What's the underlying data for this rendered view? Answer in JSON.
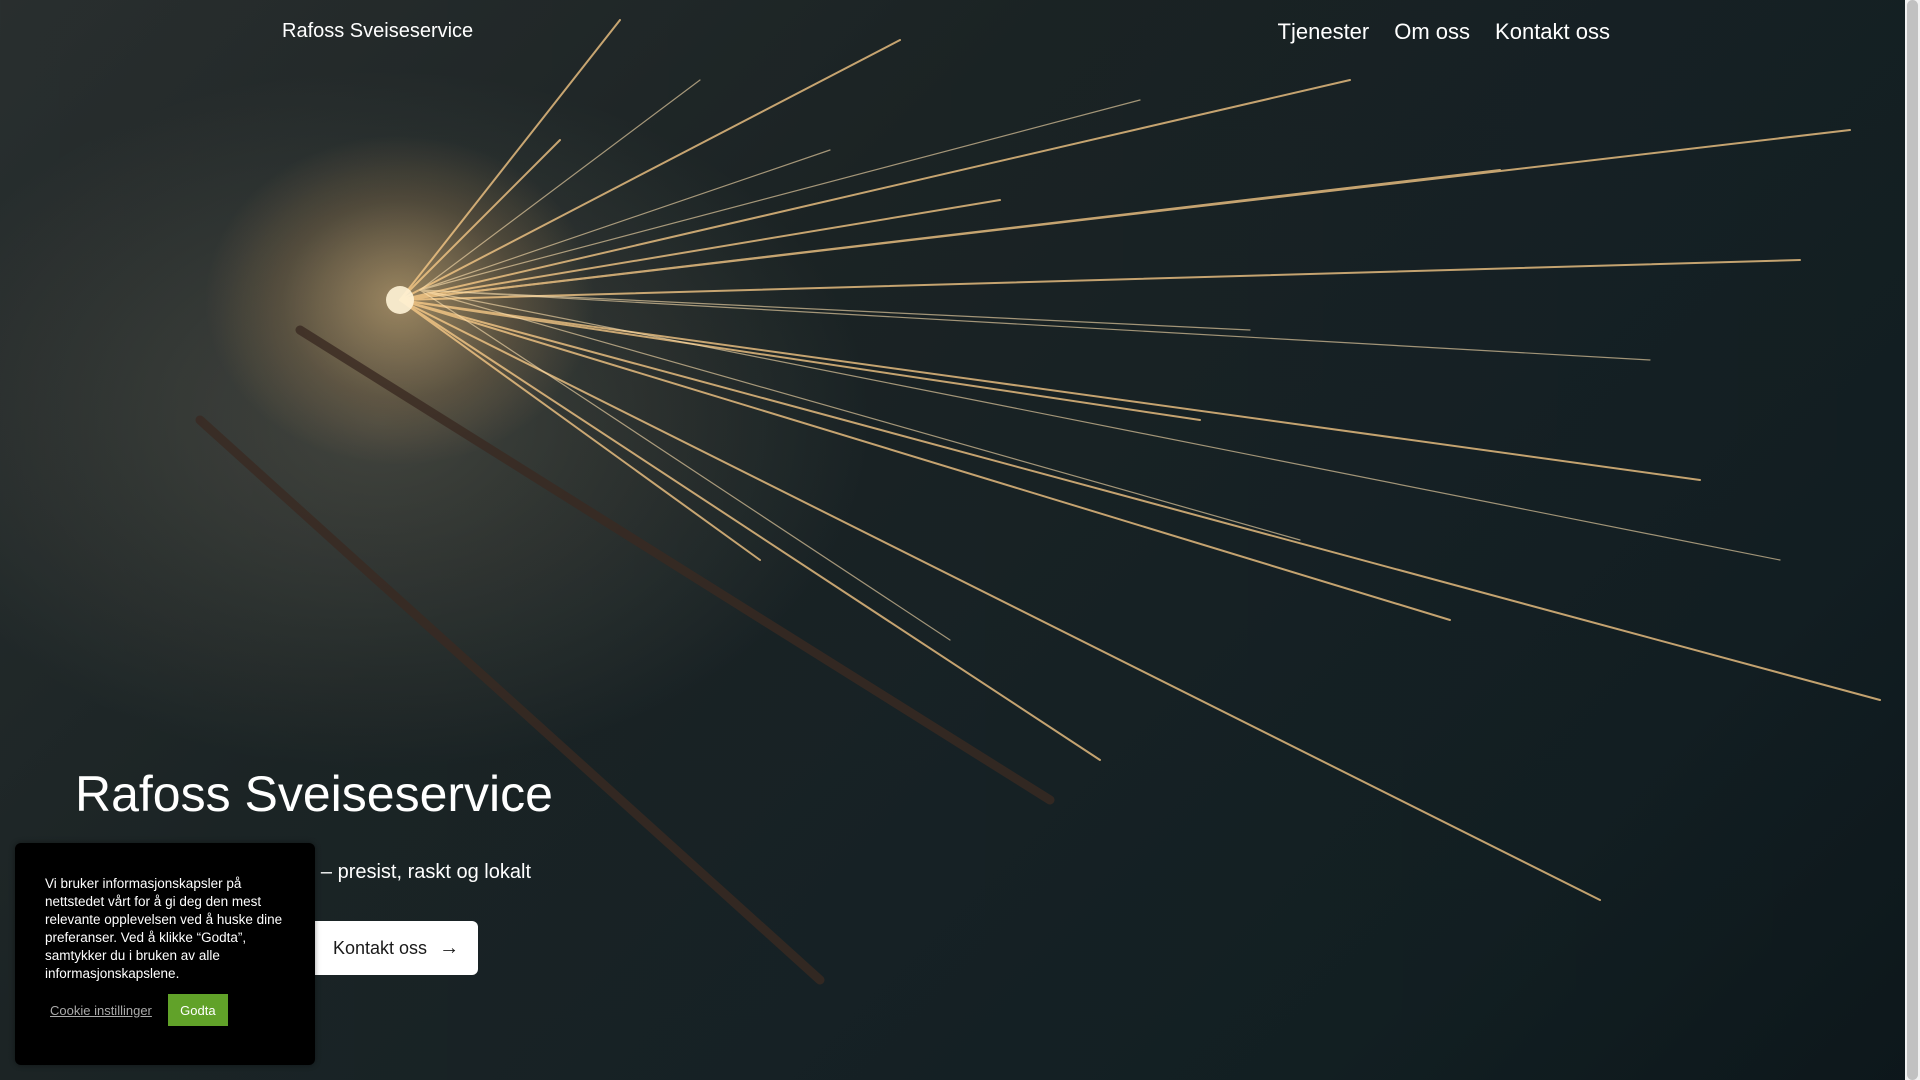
{
  "header": {
    "brand": "Rafoss Sveiseservice",
    "nav": [
      "Tjenester",
      "Om oss",
      "Kontakt oss"
    ]
  },
  "hero": {
    "title": "Rafoss Sveiseservice",
    "subtitle": "– presist, raskt og lokalt",
    "cta_label": "Kontakt oss",
    "cta_icon": "arrow-right-icon"
  },
  "cookie": {
    "text": "Vi bruker informasjonskapsler på nettstedet vårt for å gi deg den mest relevante opplevelsen ved å huske dine preferanser. Ved å klikke “Godta”, samtykker du i bruken av alle informasjonskapslene.",
    "settings_label": "Cookie instillinger",
    "accept_label": "Godta",
    "accept_color": "#61a229"
  }
}
